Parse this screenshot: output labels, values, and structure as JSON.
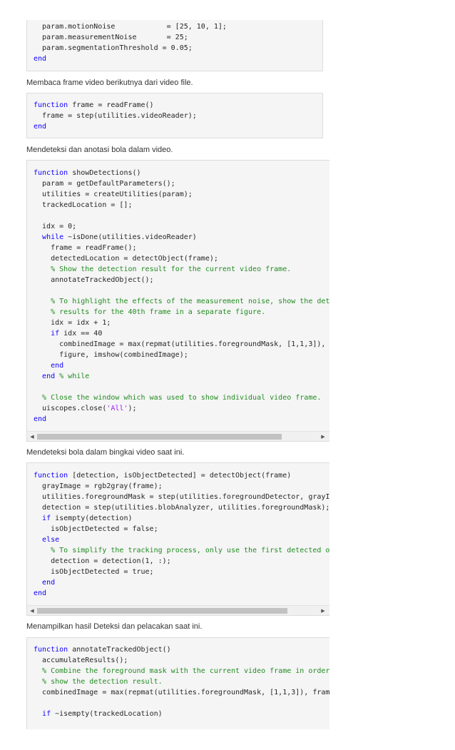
{
  "block1": {
    "lines": [
      [
        [
          "",
          "  param.motionNoise            = [25, 10, 1];"
        ]
      ],
      [
        [
          "",
          "  param.measurementNoise       = 25;"
        ]
      ],
      [
        [
          "",
          "  param.segmentationThreshold = 0.05;"
        ]
      ],
      [
        [
          "kw",
          "end"
        ]
      ]
    ]
  },
  "text1": "Membaca frame video berikutnya dari video file.",
  "block2": {
    "lines": [
      [
        [
          "kw",
          "function"
        ],
        [
          "",
          " frame = readFrame()"
        ]
      ],
      [
        [
          "",
          "  frame = step(utilities.videoReader);"
        ]
      ],
      [
        [
          "kw",
          "end"
        ]
      ]
    ]
  },
  "text2": "Mendeteksi dan anotasi bola dalam video.",
  "block3": {
    "lines": [
      [
        [
          "kw",
          "function"
        ],
        [
          "",
          " showDetections()"
        ]
      ],
      [
        [
          "",
          "  param = getDefaultParameters();"
        ]
      ],
      [
        [
          "",
          "  utilities = createUtilities(param);"
        ]
      ],
      [
        [
          "",
          "  trackedLocation = [];"
        ]
      ],
      [
        [
          "",
          ""
        ]
      ],
      [
        [
          "",
          "  idx = 0;"
        ]
      ],
      [
        [
          "",
          "  "
        ],
        [
          "kw",
          "while"
        ],
        [
          "",
          " ~isDone(utilities.videoReader)"
        ]
      ],
      [
        [
          "",
          "    frame = readFrame();"
        ]
      ],
      [
        [
          "",
          "    detectedLocation = detectObject(frame);"
        ]
      ],
      [
        [
          "",
          "    "
        ],
        [
          "cm",
          "% Show the detection result for the current video frame."
        ]
      ],
      [
        [
          "",
          "    annotateTrackedObject();"
        ]
      ],
      [
        [
          "",
          ""
        ]
      ],
      [
        [
          "",
          "    "
        ],
        [
          "cm",
          "% To highlight the effects of the measurement noise, show the dete"
        ]
      ],
      [
        [
          "",
          "    "
        ],
        [
          "cm",
          "% results for the 40th frame in a separate figure."
        ]
      ],
      [
        [
          "",
          "    idx = idx + 1;"
        ]
      ],
      [
        [
          "",
          "    "
        ],
        [
          "kw",
          "if"
        ],
        [
          "",
          " idx == 40"
        ]
      ],
      [
        [
          "",
          "      combinedImage = max(repmat(utilities.foregroundMask, [1,1,3]), f"
        ]
      ],
      [
        [
          "",
          "      figure, imshow(combinedImage);"
        ]
      ],
      [
        [
          "",
          "    "
        ],
        [
          "kw",
          "end"
        ]
      ],
      [
        [
          "",
          "  "
        ],
        [
          "kw",
          "end"
        ],
        [
          "",
          " "
        ],
        [
          "cm",
          "% while"
        ]
      ],
      [
        [
          "",
          ""
        ]
      ],
      [
        [
          "",
          "  "
        ],
        [
          "cm",
          "% Close the window which was used to show individual video frame."
        ]
      ],
      [
        [
          "",
          "  uiscopes.close("
        ],
        [
          "st",
          "'All'"
        ],
        [
          "",
          ");"
        ]
      ],
      [
        [
          "kw",
          "end"
        ]
      ]
    ],
    "scroll_thumb_fraction": 0.87
  },
  "text3": "Mendeteksi bola dalam bingkai video saat ini.",
  "block4": {
    "lines": [
      [
        [
          "kw",
          "function"
        ],
        [
          "",
          " [detection, isObjectDetected] = detectObject(frame)"
        ]
      ],
      [
        [
          "",
          "  grayImage = rgb2gray(frame);"
        ]
      ],
      [
        [
          "",
          "  utilities.foregroundMask = step(utilities.foregroundDetector, grayIm"
        ]
      ],
      [
        [
          "",
          "  detection = step(utilities.blobAnalyzer, utilities.foregroundMask);"
        ]
      ],
      [
        [
          "",
          "  "
        ],
        [
          "kw",
          "if"
        ],
        [
          "",
          " isempty(detection)"
        ]
      ],
      [
        [
          "",
          "    isObjectDetected = false;"
        ]
      ],
      [
        [
          "",
          "  "
        ],
        [
          "kw",
          "else"
        ]
      ],
      [
        [
          "",
          "    "
        ],
        [
          "cm",
          "% To simplify the tracking process, only use the first detected ob"
        ]
      ],
      [
        [
          "",
          "    detection = detection(1, :);"
        ]
      ],
      [
        [
          "",
          "    isObjectDetected = true;"
        ]
      ],
      [
        [
          "",
          "  "
        ],
        [
          "kw",
          "end"
        ]
      ],
      [
        [
          "kw",
          "end"
        ]
      ]
    ],
    "scroll_thumb_fraction": 0.89
  },
  "text4": "Menampilkan hasil Deteksi dan pelacakan saat ini.",
  "block5": {
    "lines": [
      [
        [
          "kw",
          "function"
        ],
        [
          "",
          " annotateTrackedObject()"
        ]
      ],
      [
        [
          "",
          "  accumulateResults();"
        ]
      ],
      [
        [
          "",
          "  "
        ],
        [
          "cm",
          "% Combine the foreground mask with the current video frame in order"
        ]
      ],
      [
        [
          "",
          "  "
        ],
        [
          "cm",
          "% show the detection result."
        ]
      ],
      [
        [
          "",
          "  combinedImage = max(repmat(utilities.foregroundMask, [1,1,3]), frame"
        ]
      ],
      [
        [
          "",
          ""
        ]
      ],
      [
        [
          "",
          "  "
        ],
        [
          "kw",
          "if"
        ],
        [
          "",
          " ~isempty(trackedLocation)"
        ]
      ]
    ]
  },
  "scroll_arrows": {
    "left": "◀",
    "right": "▶"
  }
}
